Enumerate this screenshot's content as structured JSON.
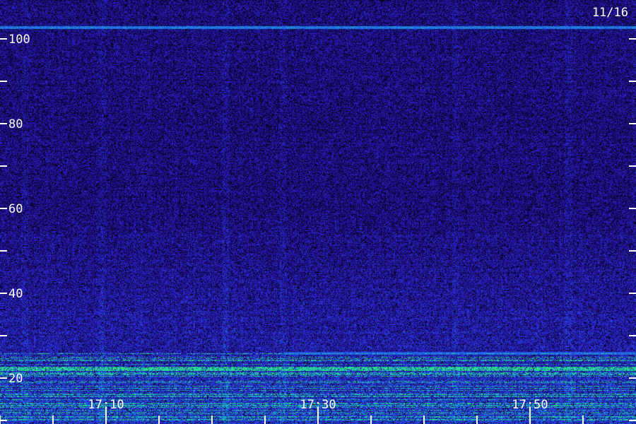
{
  "chart_data": {
    "type": "heatmap",
    "title": "",
    "date_label": "11/16",
    "xlabel": "",
    "ylabel": "",
    "y_range": [
      0,
      110
    ],
    "y_tick_labels": [
      "20",
      "40",
      "60",
      "80",
      "100"
    ],
    "y_ticks": [
      10,
      20,
      30,
      40,
      50,
      60,
      70,
      80,
      90,
      100
    ],
    "x_range": [
      "17:05",
      "17:55"
    ],
    "x_tick_labels": [
      "17:10",
      "17:30",
      "17:50"
    ],
    "x_ticks": [
      "17:00",
      "17:05",
      "17:10",
      "17:15",
      "17:20",
      "17:25",
      "17:30",
      "17:35",
      "17:40",
      "17:45",
      "17:50",
      "17:55"
    ],
    "colormap": [
      "#000000",
      "#1a0a6e",
      "#2f1fd0",
      "#1f5fe8",
      "#18c0c8",
      "#30f070"
    ],
    "features": [
      {
        "kind": "line",
        "y": 102,
        "intensity": 0.7
      },
      {
        "kind": "band",
        "y_from": 0,
        "y_to": 25,
        "intensity": 0.85
      },
      {
        "kind": "band",
        "y_from": 25,
        "y_to": 60,
        "intensity": 0.55
      }
    ]
  }
}
